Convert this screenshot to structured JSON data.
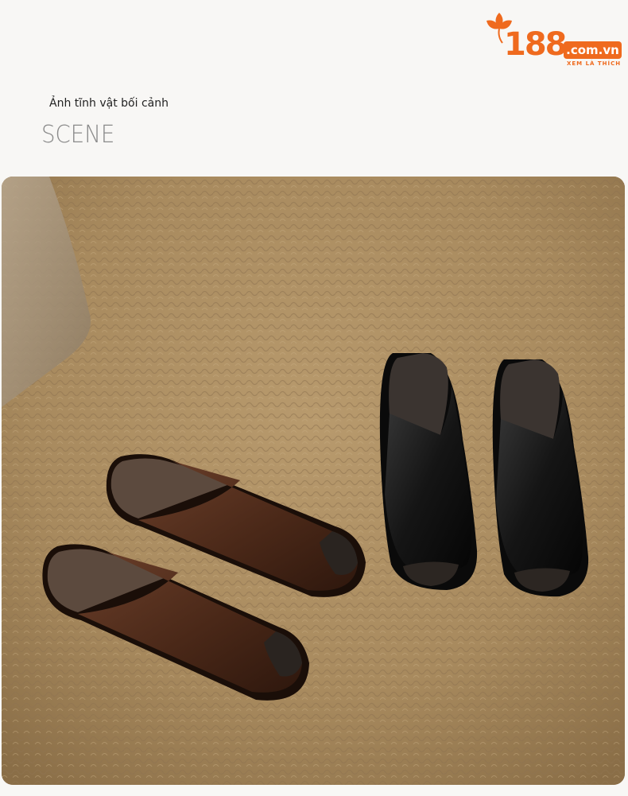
{
  "brand": {
    "number": "188",
    "domain": ".com.vn",
    "tagline": "XEM LÀ THÍCH",
    "accent": "#ef6a1e"
  },
  "header": {
    "caption": "Ảnh tĩnh vật bối cảnh",
    "title": "SCENE"
  },
  "photo": {
    "items": [
      "brown-leather-slide-pair",
      "black-leather-slide-pair",
      "woven-jute-rug",
      "mesh-fabric-bag"
    ],
    "colors": {
      "rug": "#a98a5f",
      "brown_leather": "#4a2a1c",
      "black_leather": "#141414"
    }
  }
}
